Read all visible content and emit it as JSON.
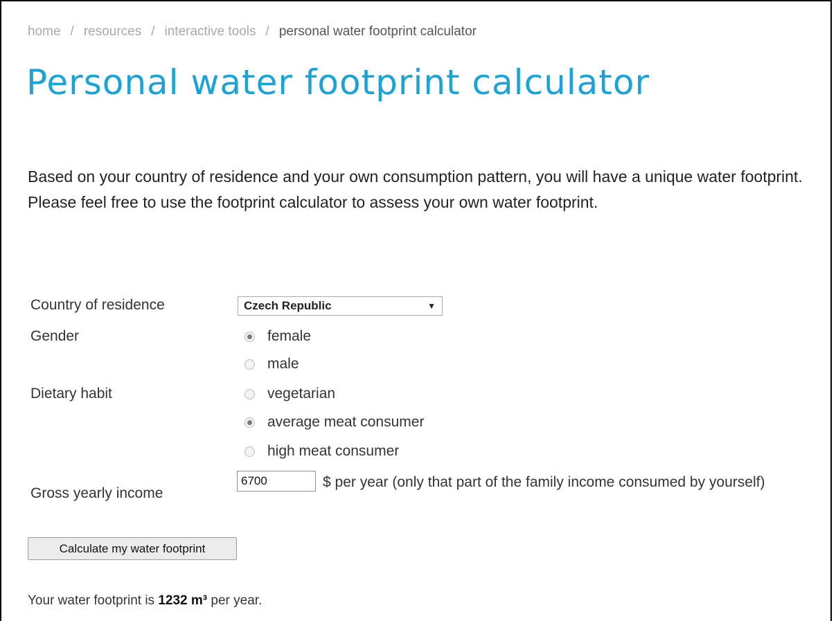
{
  "breadcrumb": {
    "items": [
      "home",
      "resources",
      "interactive tools"
    ],
    "current": "personal water footprint calculator",
    "separator": "/"
  },
  "page_title": "Personal water footprint calculator",
  "intro": "Based on your country of residence and your own consumption pattern, you will have a unique water footprint. Please feel free to use the footprint calculator to assess your own water footprint.",
  "form": {
    "country": {
      "label": "Country of residence",
      "selected": "Czech Republic",
      "caret": "▼"
    },
    "gender": {
      "label": "Gender",
      "options": [
        "female",
        "male"
      ],
      "selected": "female"
    },
    "diet": {
      "label": "Dietary habit",
      "options": [
        "vegetarian",
        "average meat consumer",
        "high meat consumer"
      ],
      "selected": "average meat consumer"
    },
    "income": {
      "label": "Gross yearly income",
      "value": "6700",
      "note": "$ per year (only that part of the family income consumed by yourself)"
    },
    "submit_label": "Calculate my water footprint"
  },
  "result": {
    "prefix": "Your water footprint is",
    "value": "1232 m³",
    "suffix": "per year."
  },
  "colors": {
    "title": "#1ca3d6",
    "breadcrumb": "#a9a9a9"
  }
}
